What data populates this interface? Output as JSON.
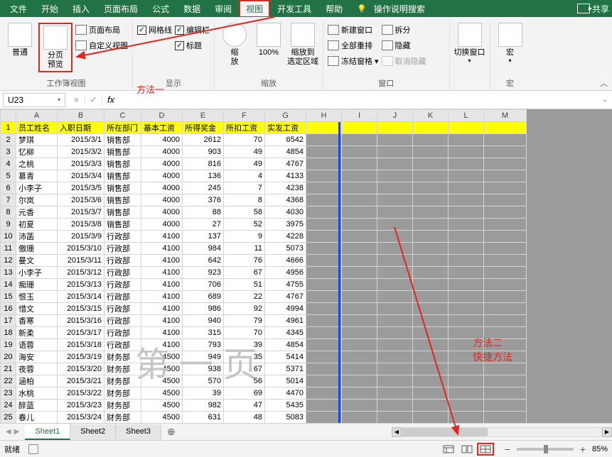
{
  "tabs": {
    "items": [
      "文件",
      "开始",
      "插入",
      "页面布局",
      "公式",
      "数据",
      "审阅",
      "视图",
      "开发工具",
      "帮助"
    ],
    "active_index": 7,
    "search": "操作说明搜索",
    "share": "共享"
  },
  "ribbon": {
    "g1": {
      "normal": "普通",
      "page_preview": "分页\n预览",
      "page_layout": "页面布局",
      "custom": "自定义视图",
      "label": "工作簿视图"
    },
    "g2": {
      "grid": "网格线",
      "edit": "编辑栏",
      "headings": "标题",
      "label": "显示"
    },
    "g3": {
      "zoom": "缩\n放",
      "hundred": "100%",
      "zoom_sel": "缩放到\n选定区域",
      "label": "缩放"
    },
    "g4": {
      "new_win": "新建窗口",
      "arrange": "全部重排",
      "freeze": "冻结窗格",
      "split": "拆分",
      "hide": "隐藏",
      "unhide": "取消隐藏",
      "label": "窗口"
    },
    "g5": {
      "switch": "切换窗口"
    },
    "g6": {
      "macro": "宏",
      "label": "宏"
    }
  },
  "annotations": {
    "m1": "方法一",
    "m2a": "方法二",
    "m2b": "快捷方法"
  },
  "namebox": "U23",
  "fx": "fx",
  "cancel": "×",
  "ok": "✓",
  "columns": [
    "A",
    "B",
    "C",
    "D",
    "E",
    "F",
    "G",
    "H",
    "I",
    "J",
    "K",
    "L",
    "M"
  ],
  "header_row": [
    "员工姓名",
    "入职日期",
    "所在部门",
    "基本工资",
    "所得奖金",
    "所扣工资",
    "实发工资"
  ],
  "rows": [
    {
      "n": 2,
      "name": "梦琪",
      "date": "2015/3/1",
      "dept": "销售部",
      "base": 4000,
      "bonus": 2612,
      "ded": 70,
      "net": 6542
    },
    {
      "n": 3,
      "name": "忆柳",
      "date": "2015/3/2",
      "dept": "销售部",
      "base": 4000,
      "bonus": 903,
      "ded": 49,
      "net": 4854
    },
    {
      "n": 4,
      "name": "之桃",
      "date": "2015/3/3",
      "dept": "销售部",
      "base": 4000,
      "bonus": 816,
      "ded": 49,
      "net": 4767
    },
    {
      "n": 5,
      "name": "慕青",
      "date": "2015/3/4",
      "dept": "销售部",
      "base": 4000,
      "bonus": 136,
      "ded": 4,
      "net": 4133
    },
    {
      "n": 6,
      "name": "小李子",
      "date": "2015/3/5",
      "dept": "销售部",
      "base": 4000,
      "bonus": 245,
      "ded": 7,
      "net": 4238
    },
    {
      "n": 7,
      "name": "尔岚",
      "date": "2015/3/6",
      "dept": "销售部",
      "base": 4000,
      "bonus": 376,
      "ded": 8,
      "net": 4368
    },
    {
      "n": 8,
      "name": "元香",
      "date": "2015/3/7",
      "dept": "销售部",
      "base": 4000,
      "bonus": 88,
      "ded": 58,
      "net": 4030
    },
    {
      "n": 9,
      "name": "初夏",
      "date": "2015/3/8",
      "dept": "销售部",
      "base": 4000,
      "bonus": 27,
      "ded": 52,
      "net": 3975
    },
    {
      "n": 10,
      "name": "沛菡",
      "date": "2015/3/9",
      "dept": "行政部",
      "base": 4100,
      "bonus": 137,
      "ded": 9,
      "net": 4228
    },
    {
      "n": 11,
      "name": "傲珊",
      "date": "2015/3/10",
      "dept": "行政部",
      "base": 4100,
      "bonus": 984,
      "ded": 11,
      "net": 5073
    },
    {
      "n": 12,
      "name": "曼文",
      "date": "2015/3/11",
      "dept": "行政部",
      "base": 4100,
      "bonus": 642,
      "ded": 76,
      "net": 4666
    },
    {
      "n": 13,
      "name": "小李子",
      "date": "2015/3/12",
      "dept": "行政部",
      "base": 4100,
      "bonus": 923,
      "ded": 67,
      "net": 4956
    },
    {
      "n": 14,
      "name": "痴珊",
      "date": "2015/3/13",
      "dept": "行政部",
      "base": 4100,
      "bonus": 706,
      "ded": 51,
      "net": 4755
    },
    {
      "n": 15,
      "name": "恨玉",
      "date": "2015/3/14",
      "dept": "行政部",
      "base": 4100,
      "bonus": 689,
      "ded": 22,
      "net": 4767
    },
    {
      "n": 16,
      "name": "惜文",
      "date": "2015/3/15",
      "dept": "行政部",
      "base": 4100,
      "bonus": 986,
      "ded": 92,
      "net": 4994
    },
    {
      "n": 17,
      "name": "香寒",
      "date": "2015/3/16",
      "dept": "行政部",
      "base": 4100,
      "bonus": 940,
      "ded": 79,
      "net": 4961
    },
    {
      "n": 18,
      "name": "新柔",
      "date": "2015/3/17",
      "dept": "行政部",
      "base": 4100,
      "bonus": 315,
      "ded": 70,
      "net": 4345
    },
    {
      "n": 19,
      "name": "语蓉",
      "date": "2015/3/18",
      "dept": "行政部",
      "base": 4100,
      "bonus": 793,
      "ded": 39,
      "net": 4854
    },
    {
      "n": 20,
      "name": "海安",
      "date": "2015/3/19",
      "dept": "财务部",
      "base": 4500,
      "bonus": 949,
      "ded": 35,
      "net": 5414
    },
    {
      "n": 21,
      "name": "夜蓉",
      "date": "2015/3/20",
      "dept": "财务部",
      "base": 4500,
      "bonus": 938,
      "ded": 67,
      "net": 5371
    },
    {
      "n": 22,
      "name": "涵柏",
      "date": "2015/3/21",
      "dept": "财务部",
      "base": 4500,
      "bonus": 570,
      "ded": 56,
      "net": 5014
    },
    {
      "n": 23,
      "name": "水桃",
      "date": "2015/3/22",
      "dept": "财务部",
      "base": 4500,
      "bonus": 39,
      "ded": 69,
      "net": 4470
    },
    {
      "n": 24,
      "name": "醉蓝",
      "date": "2015/3/23",
      "dept": "财务部",
      "base": 4500,
      "bonus": 982,
      "ded": 47,
      "net": 5435
    },
    {
      "n": 25,
      "name": "春儿",
      "date": "2015/3/24",
      "dept": "财务部",
      "base": 4500,
      "bonus": 631,
      "ded": 48,
      "net": 5083
    }
  ],
  "watermark": "第一页",
  "sheets": [
    "Sheet1",
    "Sheet2",
    "Sheet3"
  ],
  "active_sheet": 0,
  "addsheet": "⊕",
  "status": {
    "ready": "就绪",
    "rec_off": "",
    "zoom": "85%"
  }
}
